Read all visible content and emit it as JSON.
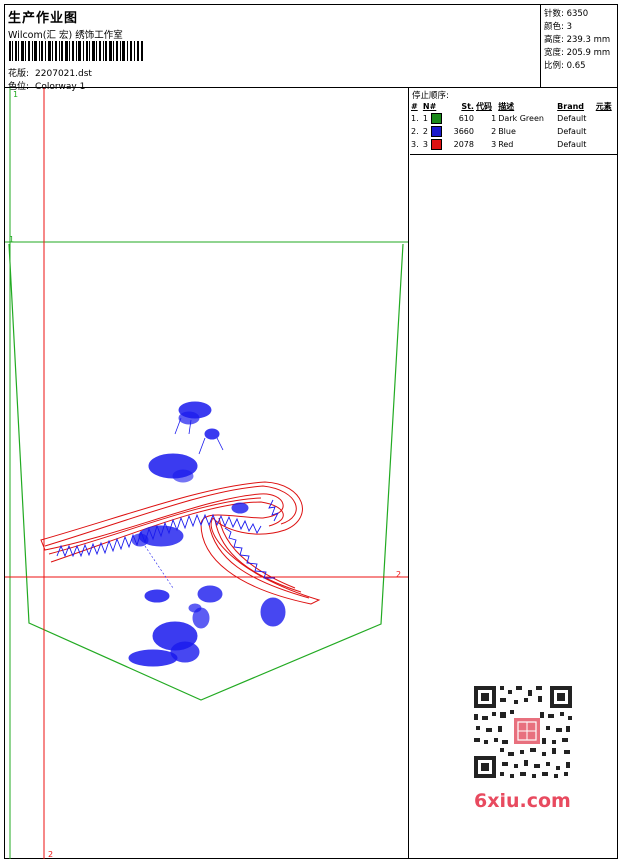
{
  "header": {
    "title": "生产作业图",
    "subtitle": "Wilcom(汇 宏) 绣饰工作室",
    "design_label": "花版:",
    "design_value": "2207021.dst",
    "color_label": "色位:",
    "color_value": "Colorway 1"
  },
  "stats": {
    "stitches_label": "针数:",
    "stitches_value": "6350",
    "colors_label": "颜色:",
    "colors_value": "3",
    "height_label": "高度:",
    "height_value": "239.3 mm",
    "width_label": "宽度:",
    "width_value": "205.9 mm",
    "scale_label": "比例:",
    "scale_value": "0.65"
  },
  "stop_sequence": {
    "title": "停止顺序:",
    "columns": [
      "#",
      "N#",
      "St.",
      "代码",
      "描述",
      "Brand",
      "元素"
    ],
    "rows": [
      {
        "idx": "1.",
        "n": "1",
        "color": "#1a8a1a",
        "st": "610",
        "code": "1",
        "desc": "Dark Green",
        "brand": "Default"
      },
      {
        "idx": "2.",
        "n": "2",
        "color": "#1a1acc",
        "st": "3660",
        "code": "2",
        "desc": "Blue",
        "brand": "Default"
      },
      {
        "idx": "3.",
        "n": "3",
        "color": "#dd1111",
        "st": "2078",
        "code": "3",
        "desc": "Red",
        "brand": "Default"
      }
    ]
  },
  "canvas_marks": {
    "green_top": "1",
    "green_left": "1",
    "red_right": "2",
    "red_bottom": "2"
  },
  "watermark": "6xiu.com",
  "colors": {
    "guide_green": "#22aa22",
    "guide_red": "#ee1111",
    "stitch_blue": "#1a1aee",
    "stitch_red": "#dd1111"
  }
}
